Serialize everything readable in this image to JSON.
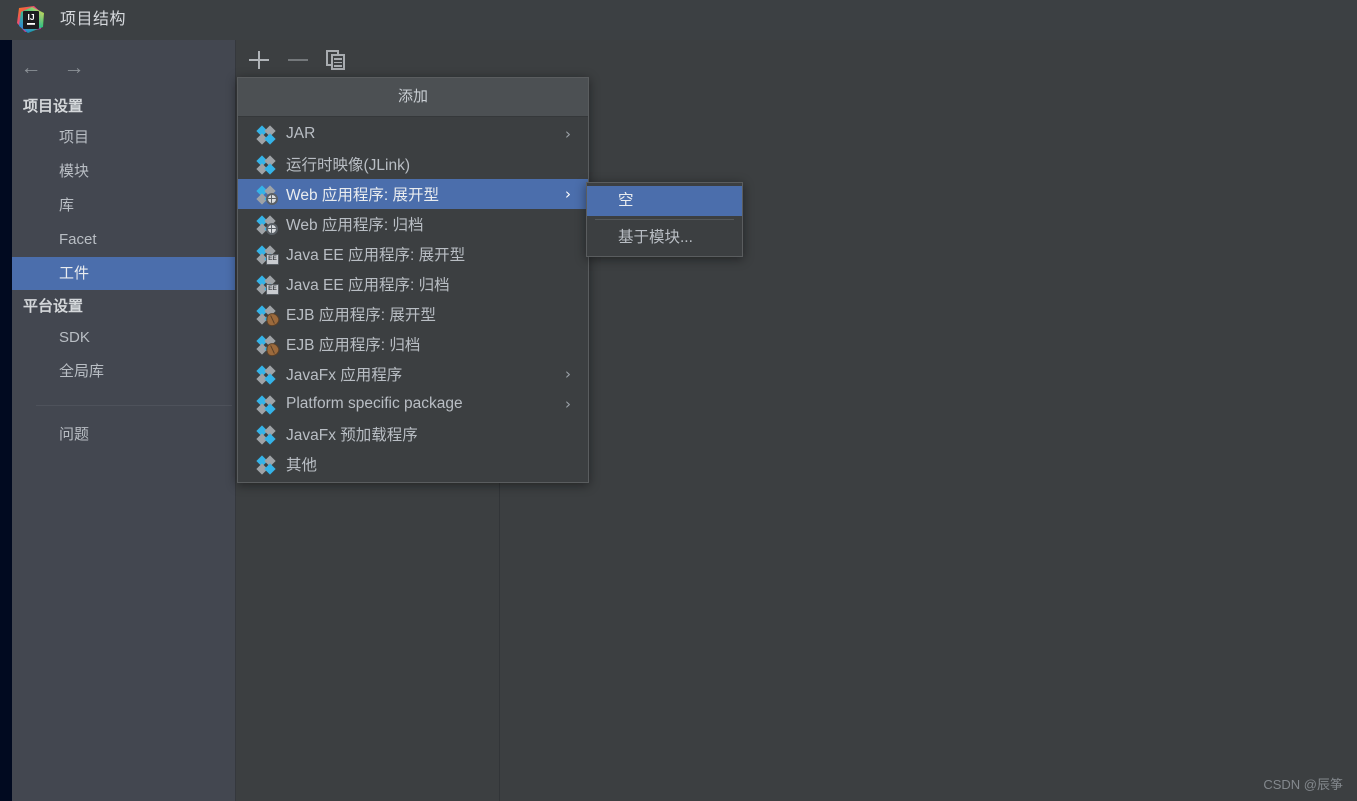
{
  "window": {
    "title": "项目结构",
    "app_icon": "intellij-idea-logo"
  },
  "sidebar": {
    "back_icon": "←",
    "forward_icon": "→",
    "groups": [
      {
        "label": "项目设置",
        "items": [
          {
            "label": "项目",
            "selected": false
          },
          {
            "label": "模块",
            "selected": false
          },
          {
            "label": "库",
            "selected": false
          },
          {
            "label": "Facet",
            "selected": false
          },
          {
            "label": "工件",
            "selected": true
          }
        ]
      },
      {
        "label": "平台设置",
        "items": [
          {
            "label": "SDK",
            "selected": false
          },
          {
            "label": "全局库",
            "selected": false
          }
        ]
      }
    ],
    "footer_item": {
      "label": "问题",
      "selected": false
    }
  },
  "toolbar": {
    "add_icon": "plus-icon",
    "remove_icon": "minus-icon",
    "copy_icon": "copy-icon",
    "add_label": "+",
    "remove_label": "−",
    "remove_disabled": true
  },
  "menu": {
    "header": "添加",
    "items": [
      {
        "label": "JAR",
        "icon": "artifact-icon",
        "arrow": "›",
        "highlighted": false
      },
      {
        "label": "运行时映像(JLink)",
        "icon": "artifact-icon",
        "arrow": "",
        "highlighted": false
      },
      {
        "label": "Web 应用程序: 展开型",
        "icon": "artifact-web-icon",
        "arrow": "›",
        "highlighted": true
      },
      {
        "label": "Web 应用程序: 归档",
        "icon": "artifact-web-icon",
        "arrow": "",
        "highlighted": false
      },
      {
        "label": "Java EE 应用程序: 展开型",
        "icon": "artifact-ee-icon",
        "arrow": "",
        "highlighted": false
      },
      {
        "label": "Java EE 应用程序: 归档",
        "icon": "artifact-ee-icon",
        "arrow": "",
        "highlighted": false
      },
      {
        "label": "EJB 应用程序: 展开型",
        "icon": "artifact-ejb-icon",
        "arrow": "",
        "highlighted": false
      },
      {
        "label": "EJB 应用程序: 归档",
        "icon": "artifact-ejb-icon",
        "arrow": "",
        "highlighted": false
      },
      {
        "label": "JavaFx 应用程序",
        "icon": "artifact-icon",
        "arrow": "›",
        "highlighted": false
      },
      {
        "label": "Platform specific package",
        "icon": "artifact-icon",
        "arrow": "›",
        "highlighted": false
      },
      {
        "label": "JavaFx 预加载程序",
        "icon": "artifact-icon",
        "arrow": "",
        "highlighted": false
      },
      {
        "label": "其他",
        "icon": "artifact-icon",
        "arrow": "",
        "highlighted": false
      }
    ]
  },
  "submenu": {
    "items": [
      {
        "label": "空",
        "highlighted": true
      },
      {
        "label": "基于模块...",
        "highlighted": false
      }
    ]
  },
  "watermark": "CSDN @辰筝",
  "colors": {
    "background": "#3c3f41",
    "sidebar": "#434750",
    "titlebar": "#3c4043",
    "selection": "#4b6eac",
    "menu_header": "#4c5053",
    "icon_blue": "#35b3e8",
    "icon_gray": "#9fa3a7",
    "text": "#b9bec4",
    "edge_strip": "#010a20"
  }
}
